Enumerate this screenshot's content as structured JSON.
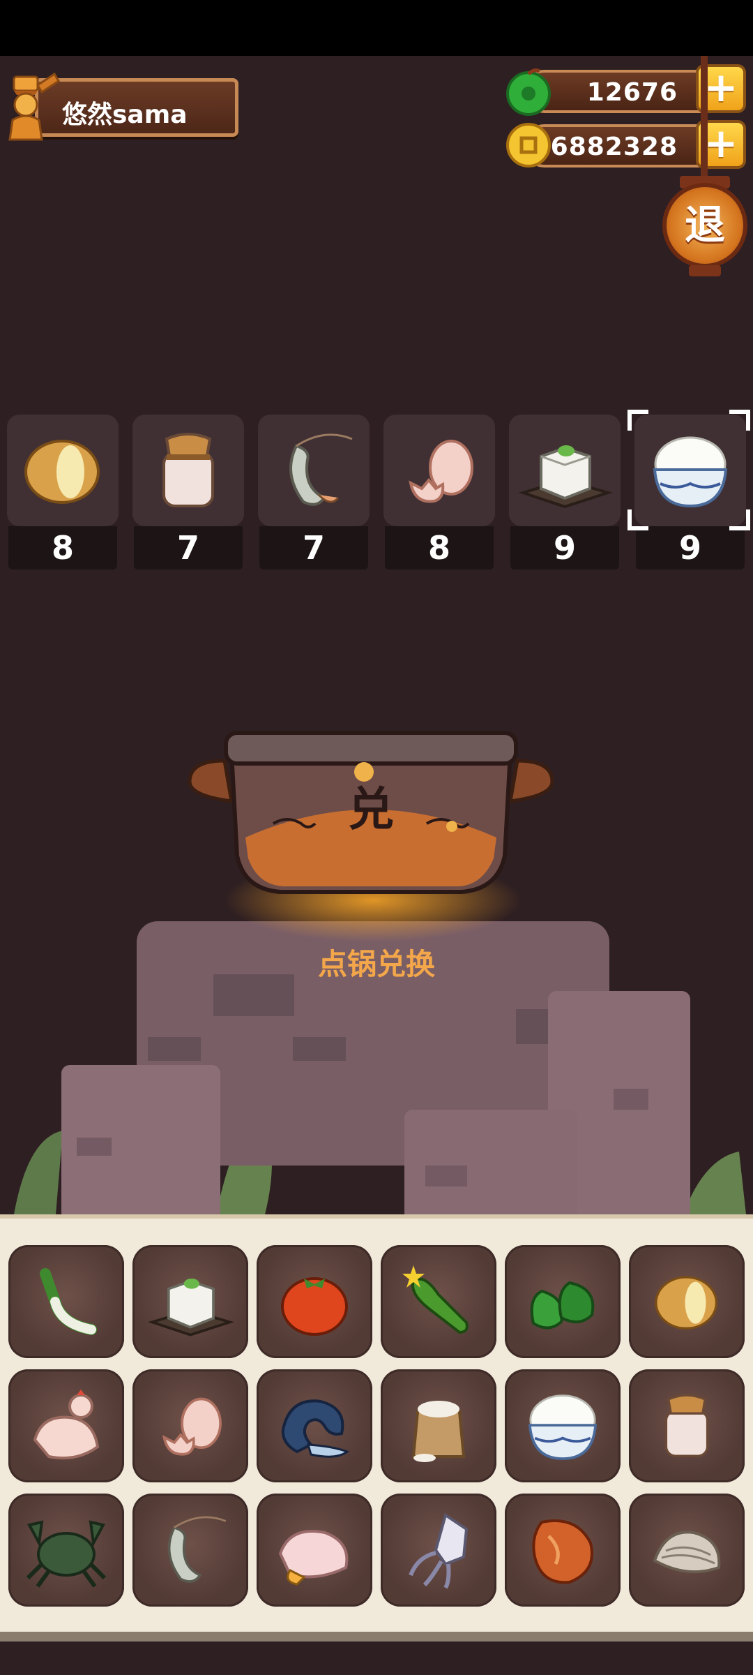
{
  "player": {
    "name": "悠然sama",
    "avatar_icon": "chef-avatar-icon"
  },
  "currencies": [
    {
      "name": "jade",
      "icon": "green-jade-icon",
      "value": "12676"
    },
    {
      "name": "coins",
      "icon": "gold-coin-icon",
      "value": "6882328"
    }
  ],
  "plus_label": "+",
  "exit_label": "退",
  "recipe": [
    {
      "item": "potato",
      "count": "8"
    },
    {
      "item": "jar",
      "count": "7"
    },
    {
      "item": "shrimp",
      "count": "7"
    },
    {
      "item": "egg",
      "count": "8"
    },
    {
      "item": "tofu",
      "count": "9"
    },
    {
      "item": "rice",
      "count": "9",
      "selected": true
    }
  ],
  "pot": {
    "char": "兑",
    "hint": "点锅兑换"
  },
  "inventory": [
    [
      "leek",
      "tofu",
      "tomato",
      "cucumber",
      "pepper",
      "potato"
    ],
    [
      "chicken",
      "egg",
      "fish",
      "flour",
      "rice",
      "jar"
    ],
    [
      "crab",
      "shrimp",
      "duck",
      "squid",
      "meat",
      "clam"
    ]
  ],
  "colors": {
    "background": "#2e1f22",
    "accent": "#f3a74a",
    "panel": "#f1e9d9"
  }
}
